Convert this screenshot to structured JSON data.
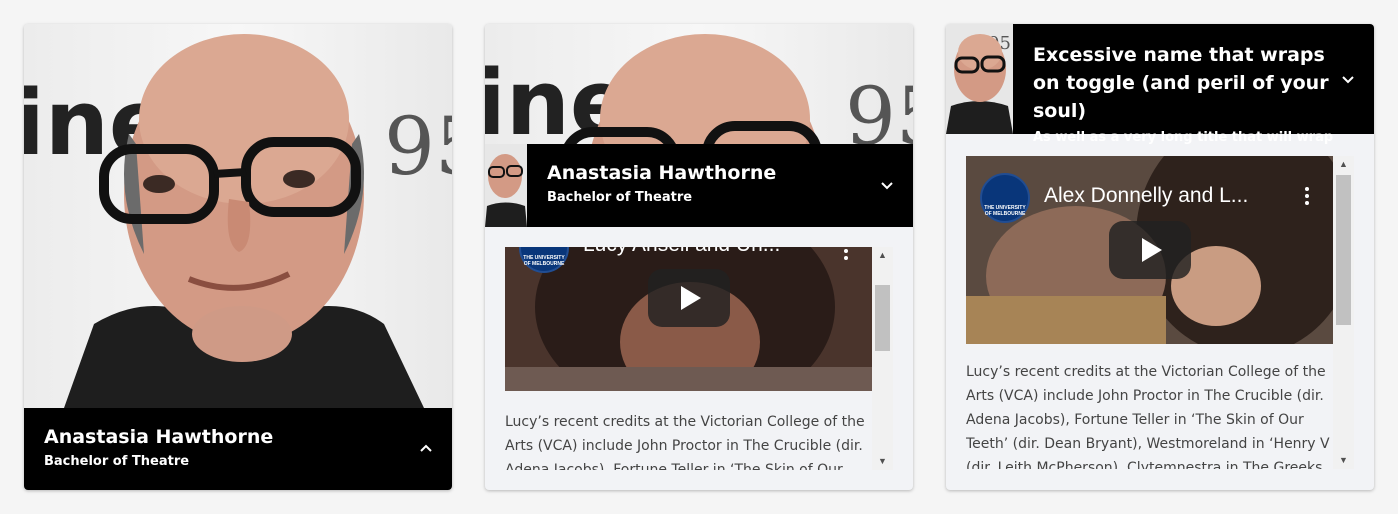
{
  "cards": [
    {
      "name": "Anastasia Hawthorne",
      "title": "Bachelor of Theatre",
      "toggle_icon": "chevron-up-icon"
    },
    {
      "name": "Anastasia Hawthorne",
      "title": "Bachelor of Theatre",
      "toggle_icon": "chevron-down-icon",
      "video": {
        "title": "Lucy Ansell and Un...",
        "logo_text": "THE UNIVERSITY OF MELBOURNE"
      },
      "bio": "Lucy’s recent credits at the Victorian College of the Arts (VCA) include John Proctor in The Crucible (dir. Adena Jacobs), Fortune Teller in ‘The Skin of Our Teeth’ (dir. Dean Bryant), Westmoreland in ‘Henry V (dir. Leith McPherson), Clytemnestra in The Greeks"
    },
    {
      "name": "Excessive name that wraps on toggle (and peril of your soul)",
      "title": "As well as a very long title that will wrap",
      "toggle_icon": "chevron-down-icon",
      "video": {
        "title": "Alex Donnelly and L...",
        "logo_text": "THE UNIVERSITY OF MELBOURNE"
      },
      "bio": "Lucy’s recent credits at the Victorian College of the Arts (VCA) include John Proctor in The Crucible (dir. Adena Jacobs), Fortune Teller in ‘The Skin of Our Teeth’ (dir. Dean Bryant), Westmoreland in ‘Henry V (dir. Leith McPherson), Clytemnestra in The Greeks"
    }
  ],
  "colors": {
    "namebar_bg": "#000000",
    "card_bg": "#f2f3f6",
    "page_bg": "#f5f5f5",
    "logo_blue": "#09367a"
  }
}
